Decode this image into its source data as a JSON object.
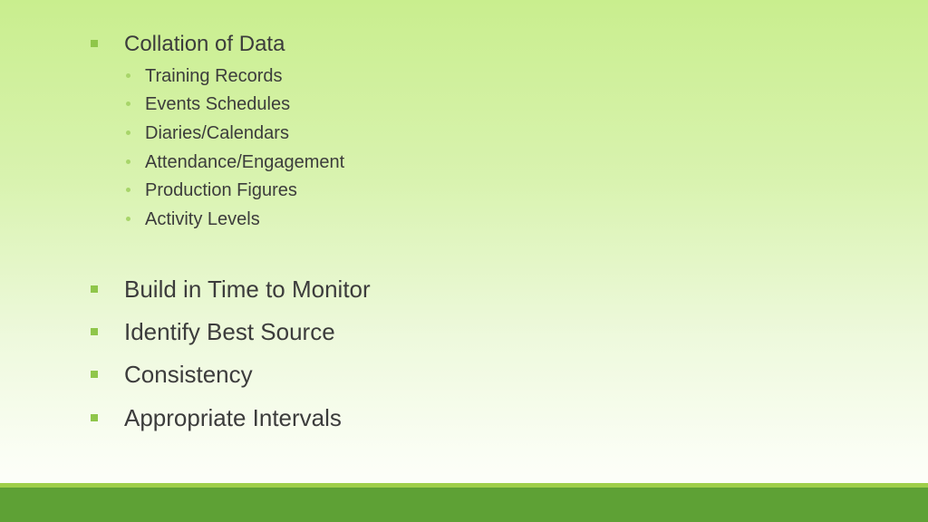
{
  "slide": {
    "first_bullet": "Collation of Data",
    "sub_bullets": [
      "Training Records",
      "Events Schedules",
      "Diaries/Calendars",
      "Attendance/Engagement",
      "Production Figures",
      "Activity Levels"
    ],
    "bullets": [
      "Build in Time to Monitor",
      "Identify Best Source",
      "Consistency",
      "Appropriate Intervals"
    ]
  },
  "colors": {
    "bullet_square": "#8fc64a",
    "sub_bullet_dot": "#a8d56a",
    "footer_light": "#9fcf4a",
    "footer_dark": "#5ea135"
  }
}
